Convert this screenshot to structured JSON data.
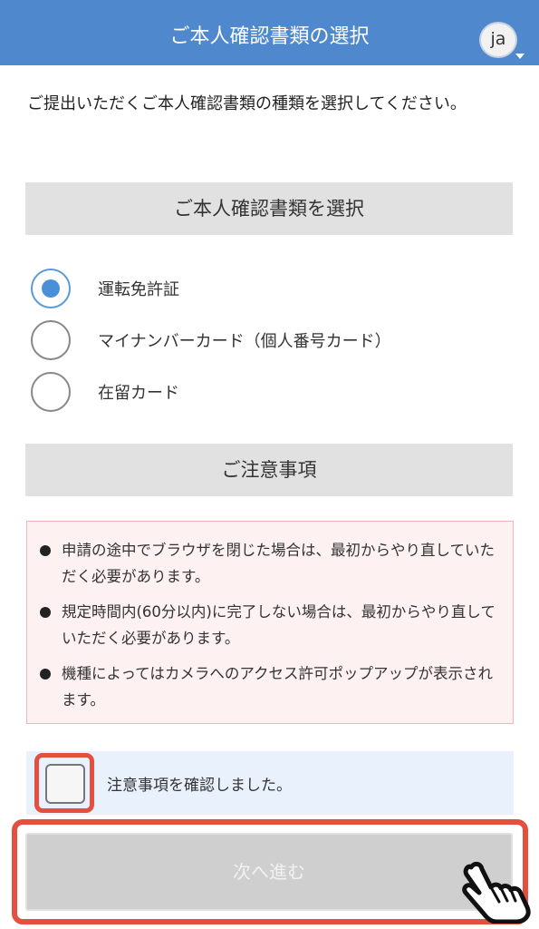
{
  "header": {
    "title": "ご本人確認書類の選択",
    "lang_label": "ja"
  },
  "intro": {
    "text": "ご提出いただくご本人確認書類の種類を選択してください。"
  },
  "doc_select": {
    "heading": "ご本人確認書類を選択",
    "options": [
      {
        "label": "運転免許証",
        "selected": true
      },
      {
        "label": "マイナンバーカード（個人番号カード）",
        "selected": false
      },
      {
        "label": "在留カード",
        "selected": false
      }
    ]
  },
  "notes": {
    "heading": "ご注意事項",
    "items": [
      "申請の途中でブラウザを閉じた場合は、最初からやり直していただく必要があります。",
      "規定時間内(60分以内)に完了しない場合は、最初からやり直していただく必要があります。",
      "機種によってはカメラへのアクセス許可ポップアップが表示されます。"
    ]
  },
  "confirm": {
    "label": "注意事項を確認しました。",
    "checked": false
  },
  "next_button": {
    "label": "次へ進む",
    "enabled": false
  },
  "colors": {
    "header": "#4f88cc",
    "highlight": "#e4503f",
    "radio_selected": "#4a90d9"
  },
  "icons": {
    "pointer": "hand-pointer-icon"
  }
}
